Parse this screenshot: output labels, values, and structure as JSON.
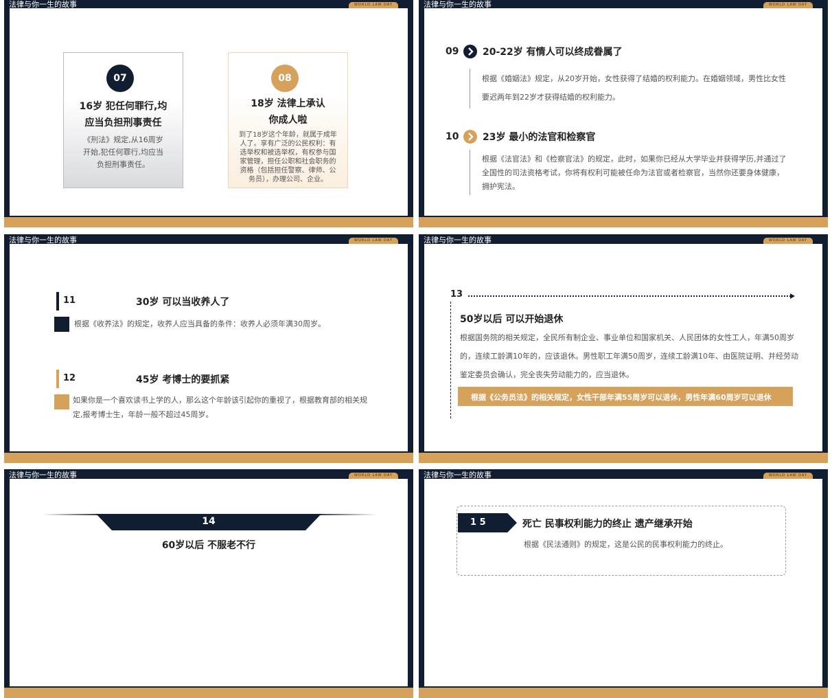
{
  "header_title": "法律与你一生的故事",
  "badge": "WORLD LAW DAY",
  "slide1": {
    "card07": {
      "num": "07",
      "title_l1": "16岁 犯任何罪行,均",
      "title_l2": "应当负担刑事责任",
      "body_l1": "《刑法》规定,从16周岁",
      "body_l2": "开始,犯任何罪行,均应当",
      "body_l3": "负担刑事责任。"
    },
    "card08": {
      "num": "08",
      "title_l1": "18岁 法律上承认",
      "title_l2": "你成人啦",
      "body_l1": "到了18岁这个年龄，就属于成年",
      "body_l2": "人了。享有广泛的公民权利：有",
      "body_l3": "选举权和被选举权，有权参与国",
      "body_l4": "家管理，担任公职和社会职务的",
      "body_l5": "资格（包括担任警察、律师、公",
      "body_l6": "务员），办理公司、企业。"
    }
  },
  "slide2": {
    "item09": {
      "num": "09",
      "title": "20-22岁 有情人可以终成眷属了",
      "l1": "根据《婚姻法》规定，从20岁开始，女性获得了结婚的权利能力。在婚姻领域，男性比女性",
      "l2": "要迟两年到22岁才获得结婚的权利能力。"
    },
    "item10": {
      "num": "10",
      "title": "23岁 最小的法官和检察官",
      "l1": "根据《法官法》和《检察官法》的规定，此时，如果你已经从大学毕业并获得学历,并通过了",
      "l2": "全国性的司法资格考试，你将有权利可能被任命为法官或者检察官，当然你还要身体健康，",
      "l3": "拥护宪法。"
    }
  },
  "slide3": {
    "item11": {
      "num": "11",
      "title": "30岁 可以当收养人了",
      "l1": "根据《收养法》的规定，收养人应当具备的条件：收养人必须年满30周岁。"
    },
    "item12": {
      "num": "12",
      "title": "45岁 考博士的要抓紧",
      "l1": "如果你是一个喜欢读书上学的人，那么这个年龄该引起你的重视了，根据教育部的相关规",
      "l2": "定,报考博士生，年龄一般不超过45周岁。"
    }
  },
  "slide4": {
    "num": "13",
    "title": "50岁以后 可以开始退休",
    "l1": "根据国务院的相关规定，全民所有制企业、事业单位和国家机关、人民团体的女性工人，年满50周岁",
    "l2": "的，连续工龄满10年的，应该退休。男性职工年满50周岁，连续工龄满10年、由医院证明、并经劳动",
    "l3": "鉴定委员会确认，完全丧失劳动能力的，应当退休。",
    "banner": "根据《公务员法》的相关规定，女性干部年满55周岁可以退休，男性年满60周岁可以退休"
  },
  "slide5": {
    "num": "14",
    "title": "60岁以后 不服老不行"
  },
  "slide6": {
    "num": "1 5",
    "title": "死亡 民事权利能力的终止 遗产继承开始",
    "l1": "根据《民法通则》的规定，这是公民的民事权利能力的终止。"
  },
  "colors": {
    "navy": "#111d30",
    "gold": "#d6a15b",
    "panel": "#ffffff"
  },
  "icons": [
    "chevron-right-icon"
  ]
}
